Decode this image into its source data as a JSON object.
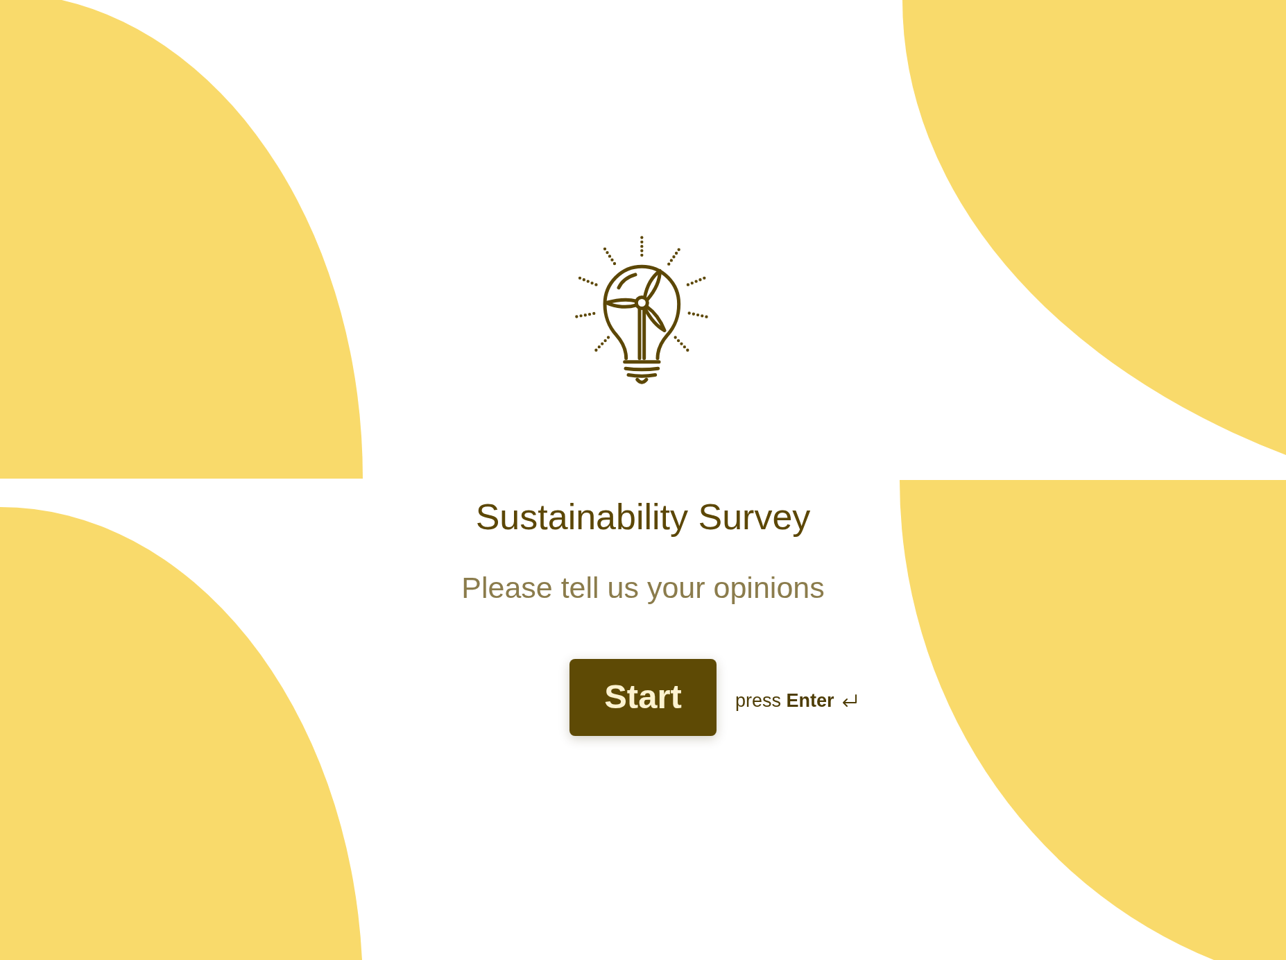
{
  "title": "Sustainability Survey",
  "subtitle": "Please tell us your opinions",
  "start_button": {
    "label": "Start"
  },
  "keyboard_hint": "press **Enter**"
}
